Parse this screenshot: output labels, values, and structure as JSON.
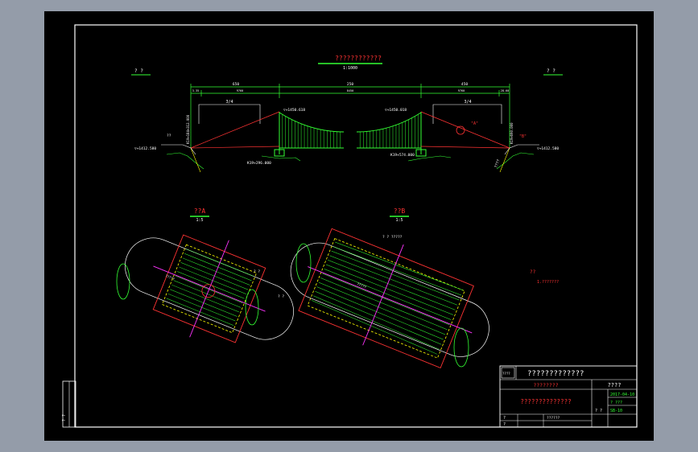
{
  "drawing": {
    "elevation": {
      "title": "????????????",
      "scale": "1:1000",
      "corner_left": "? ?",
      "corner_right": "? ?",
      "dim_total": "250",
      "dim_left": "650",
      "dim_right": "450",
      "dim_sub": [
        "3.35",
        "9760",
        "8450",
        "9760",
        "28.60"
      ],
      "slope_left": "3/4",
      "slope_right": "3/4",
      "level_left_tower": "▽+1450.618",
      "level_right_tower": "▽+1450.018",
      "level_left_bank": "▽+1412.580",
      "level_right_bank": "▽+1412.580",
      "chainage_left": "K19+296.000",
      "chainage_right": "K19+574.000",
      "side_left": "K19+184+312.000",
      "side_right": "K19+690.000",
      "mark_a": "\"A\"",
      "mark_b": "\"B\"",
      "tag_left": "??",
      "tag_right": "????"
    },
    "detail_a": {
      "title": "??A",
      "scale": "1:5",
      "label_cable": "?????",
      "label_end": "? ?"
    },
    "detail_b": {
      "title": "??B",
      "scale": "1:5",
      "label_top": "? ? ?????",
      "label_mid": "?????",
      "label_left": "? ?"
    },
    "notes": {
      "heading": "??",
      "line1": "1.???????"
    },
    "title_block": {
      "logo": "????",
      "project": "?????????????",
      "drawing_name": "????????",
      "drawing_no": "????",
      "subtitle": "??????????????",
      "date": "2017-04-10",
      "sheet": "? ???",
      "scale_label": "? ?",
      "scale_value": "SB-10",
      "row_a": "?",
      "row_b": "?",
      "row_c": "??????"
    },
    "side_strip": {
      "label": "? ?"
    },
    "colors": {
      "background": "#000000",
      "line": "#ffffff",
      "geometry": "#33ff33",
      "accent": "#ff3333",
      "member": "#ff33ff",
      "highlight": "#ffff00"
    }
  }
}
